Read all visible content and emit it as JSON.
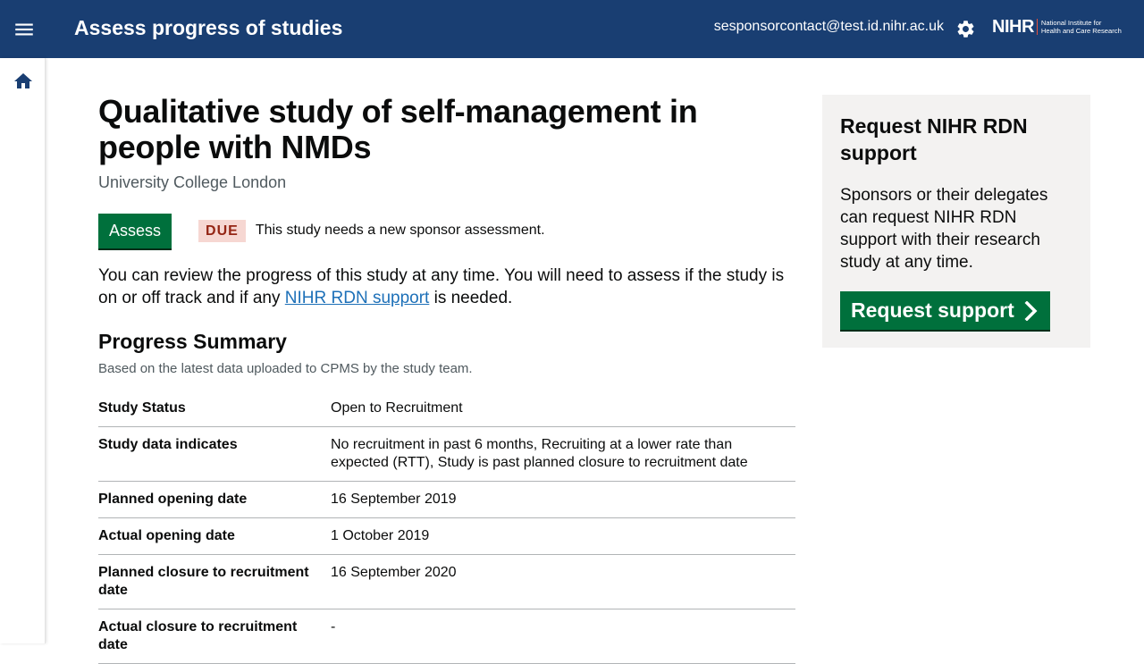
{
  "header": {
    "title": "Assess progress of studies",
    "user_email": "sesponsorcontact@test.id.nihr.ac.uk",
    "logo_mark": "NIHR",
    "logo_line1": "National Institute for",
    "logo_line2": "Health and Care Research"
  },
  "icons": {
    "menu": "menu-icon",
    "settings": "gear-icon",
    "home": "home-icon",
    "chevron": "chevron-right-icon"
  },
  "colors": {
    "header_bg": "#193e72",
    "primary_button": "#00703c",
    "link": "#1d70b8",
    "due_tag_bg": "#f6d7d2",
    "due_tag_text": "#942514"
  },
  "study": {
    "title": "Qualitative study of self-management in people with NMDs",
    "organisation": "University College London",
    "assess_label": "Assess",
    "due_tag": "DUE",
    "due_message": "This study needs a new sponsor assessment.",
    "intro_before_link": "You can review the progress of this study at any time. You will need to assess if the study is on or off track and if any ",
    "intro_link": "NIHR RDN support",
    "intro_after_link": " is needed."
  },
  "progress": {
    "heading": "Progress Summary",
    "caption": "Based on the latest data uploaded to CPMS by the study team.",
    "rows": [
      {
        "label": "Study Status",
        "value": "Open to Recruitment"
      },
      {
        "label": "Study data indicates",
        "value": "No recruitment in past 6 months, Recruiting at a lower rate than expected (RTT), Study is past planned closure to recruitment date"
      },
      {
        "label": "Planned opening date",
        "value": "16 September 2019"
      },
      {
        "label": "Actual opening date",
        "value": "1 October 2019"
      },
      {
        "label": "Planned closure to recruitment date",
        "value": "16 September 2020"
      },
      {
        "label": "Actual closure to recruitment date",
        "value": "-"
      }
    ]
  },
  "aside": {
    "title": "Request NIHR RDN support",
    "body": "Sponsors or their delegates can request NIHR RDN support with their research study at any time.",
    "button_label": "Request support"
  }
}
